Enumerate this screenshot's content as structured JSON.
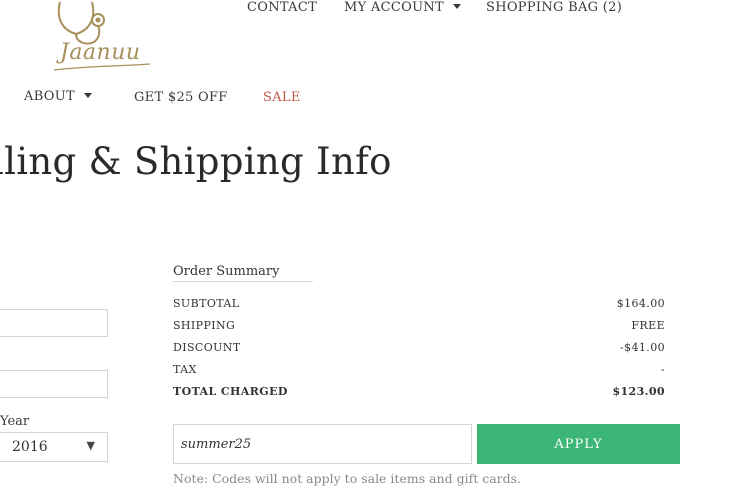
{
  "brand": {
    "logo_text": "Jaanuu",
    "accent_color": "#a7905b"
  },
  "top_nav": {
    "contact": "CONTACT",
    "my_account": "MY ACCOUNT",
    "shopping_bag": "SHOPPING BAG (2)"
  },
  "main_nav": {
    "about": "ABOUT",
    "get_offer": "GET $25 OFF",
    "sale": "SALE",
    "sale_color": "#c0574a"
  },
  "page_title": "lling & Shipping Info",
  "form": {
    "year_label": "Year",
    "year_value": "2016"
  },
  "order_summary": {
    "title": "Order Summary",
    "rows": [
      {
        "label": "SUBTOTAL",
        "value": "$164.00"
      },
      {
        "label": "SHIPPING",
        "value": "FREE"
      },
      {
        "label": "DISCOUNT",
        "value": "-$41.00"
      },
      {
        "label": "TAX",
        "value": "-"
      },
      {
        "label": "TOTAL CHARGED",
        "value": "$123.00"
      }
    ]
  },
  "promo": {
    "code_value": "summer25",
    "apply_label": "APPLY",
    "button_color": "#3bb677",
    "note": "Note: Codes will not apply to sale items and gift cards."
  }
}
